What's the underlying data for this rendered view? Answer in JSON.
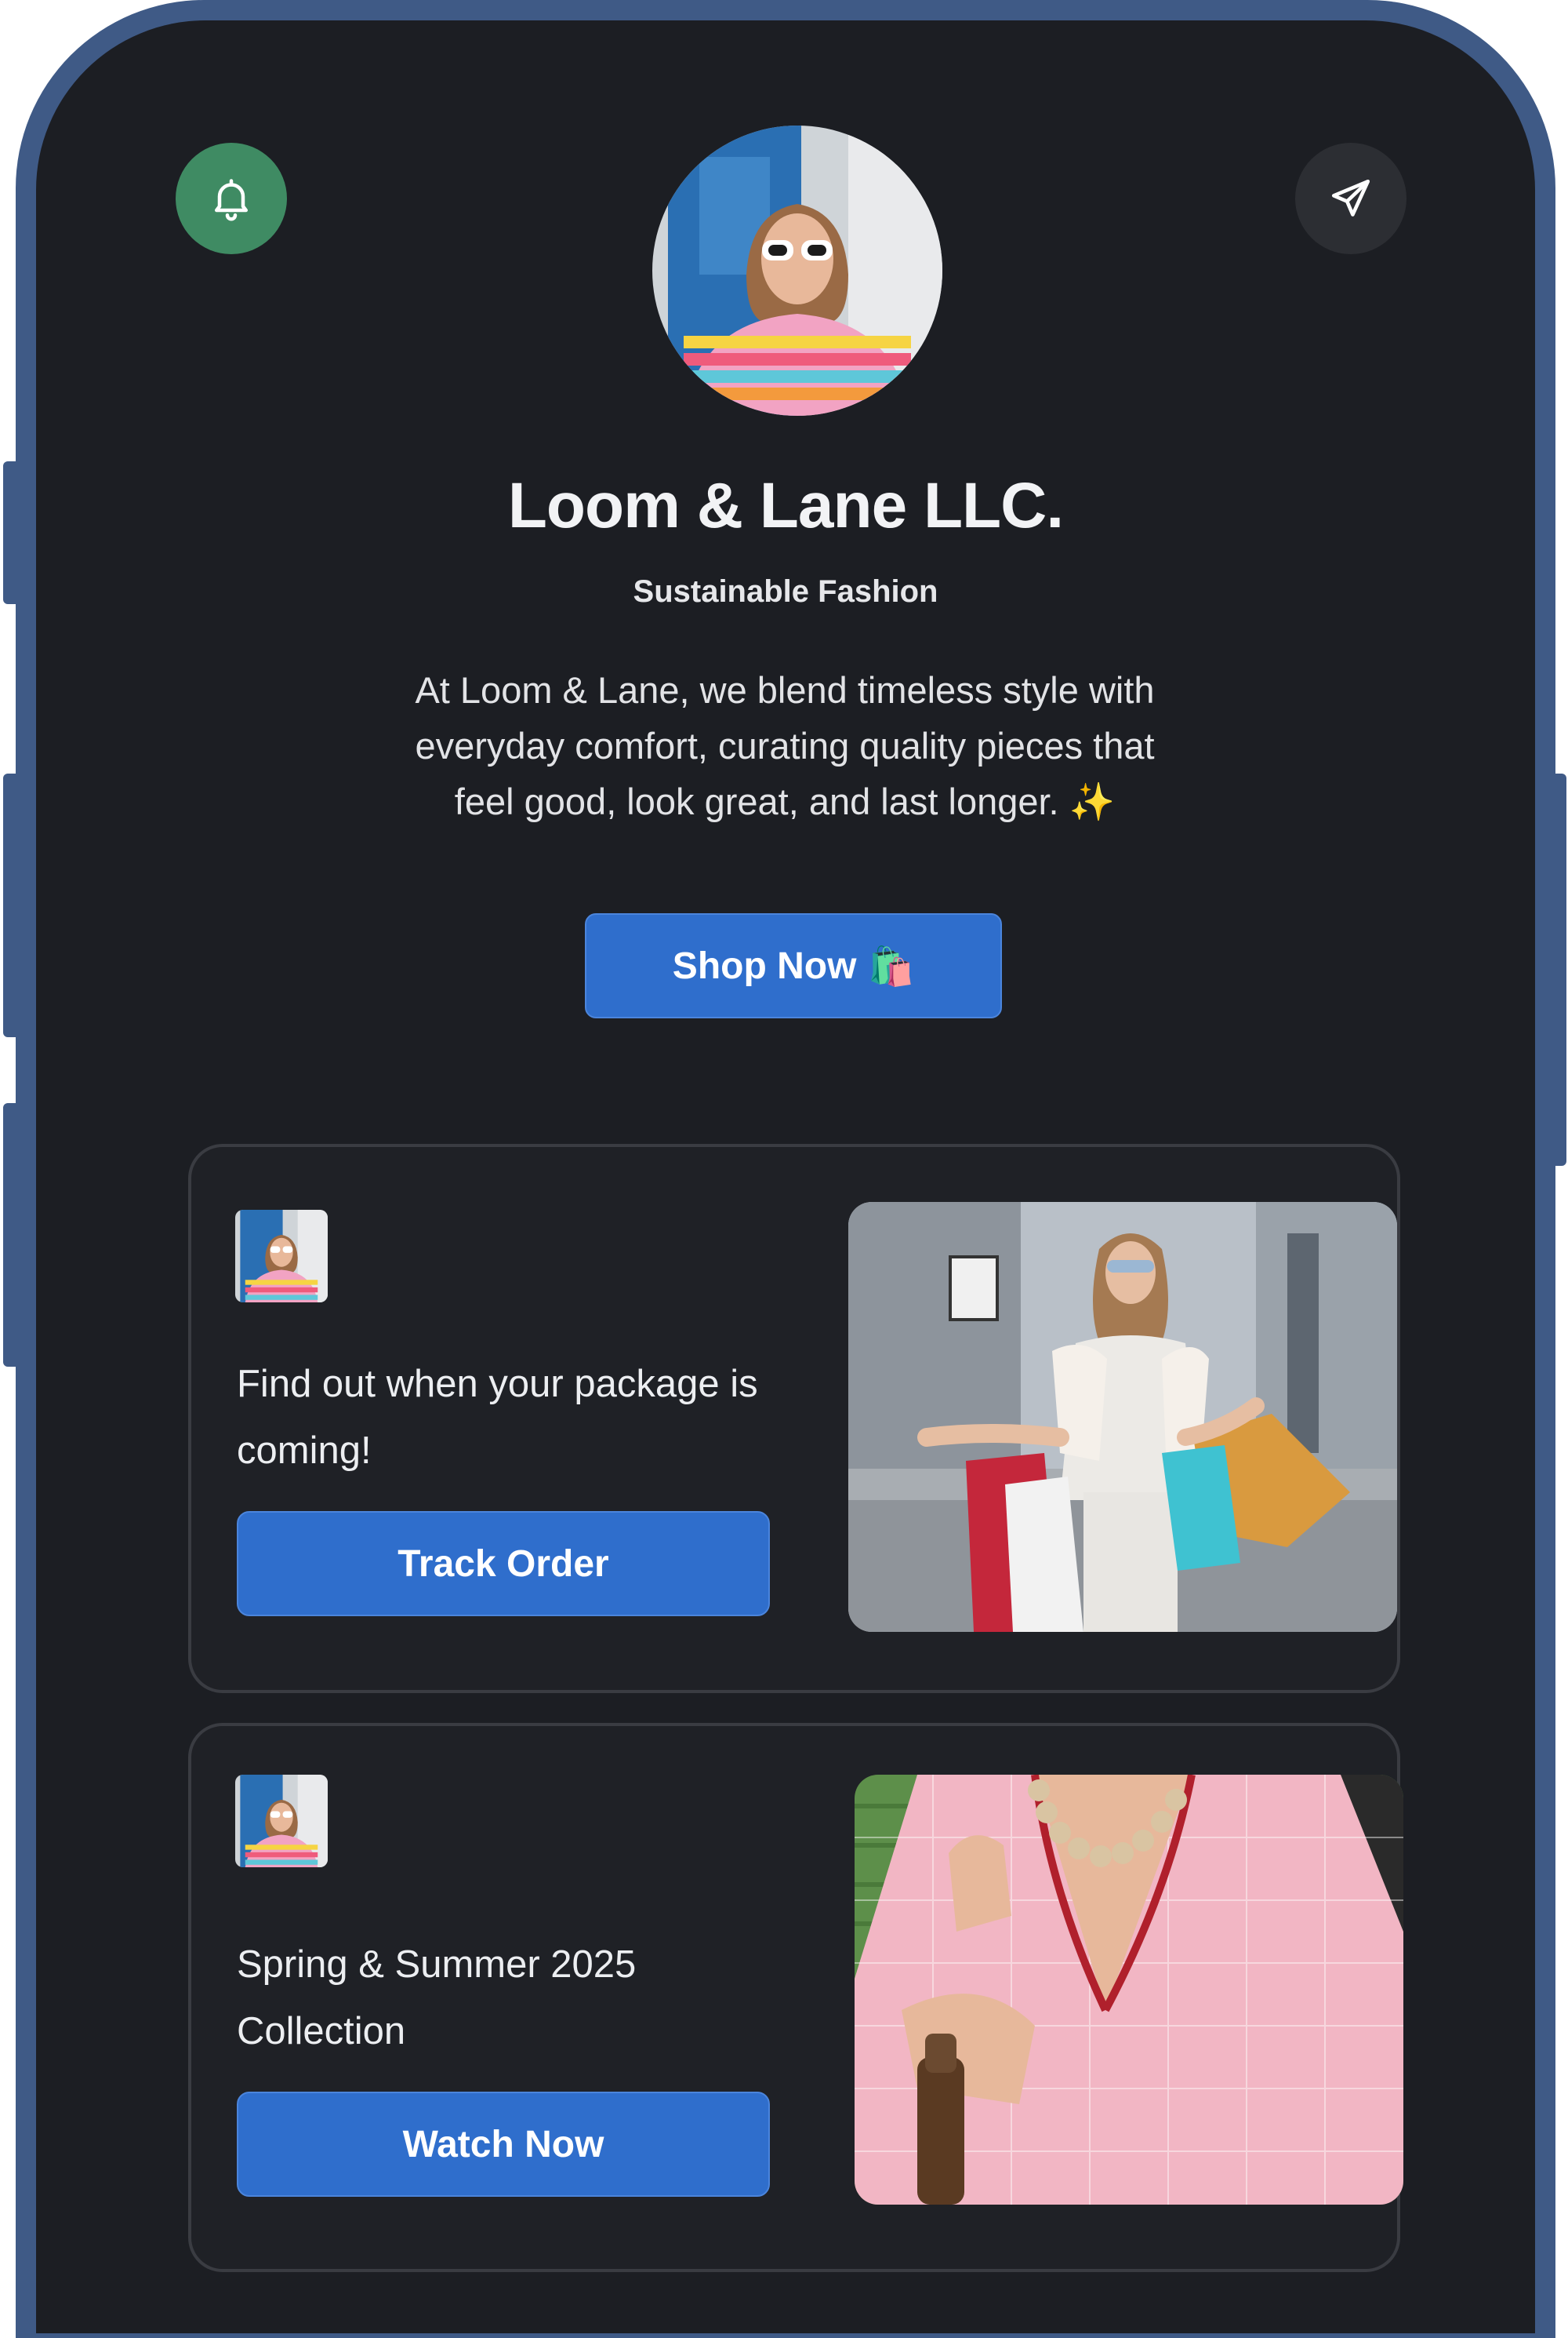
{
  "profile": {
    "name": "Loom & Lane LLC.",
    "tagline": "Sustainable Fashion",
    "bio": "At Loom & Lane, we blend timeless style with everyday comfort, curating quality pieces that feel good, look great, and last longer. ✨",
    "cta_label": "Shop Now",
    "cta_emoji": "🛍️"
  },
  "header": {
    "left_icon": "bell-icon",
    "right_icon": "send-icon"
  },
  "cards": [
    {
      "text": "Find out when your package is coming!",
      "button_label": "Track Order",
      "photo": "woman-with-shopping-bags"
    },
    {
      "text": "Spring & Summer 2025 Collection",
      "button_label": "Watch Now",
      "photo": "woman-in-pink-blouse"
    }
  ],
  "colors": {
    "background": "#1c1e23",
    "frame": "#3f5a86",
    "accent_blue": "#2f6ecc",
    "bell_green": "#3f8b63",
    "card_border": "#3a3c42"
  }
}
